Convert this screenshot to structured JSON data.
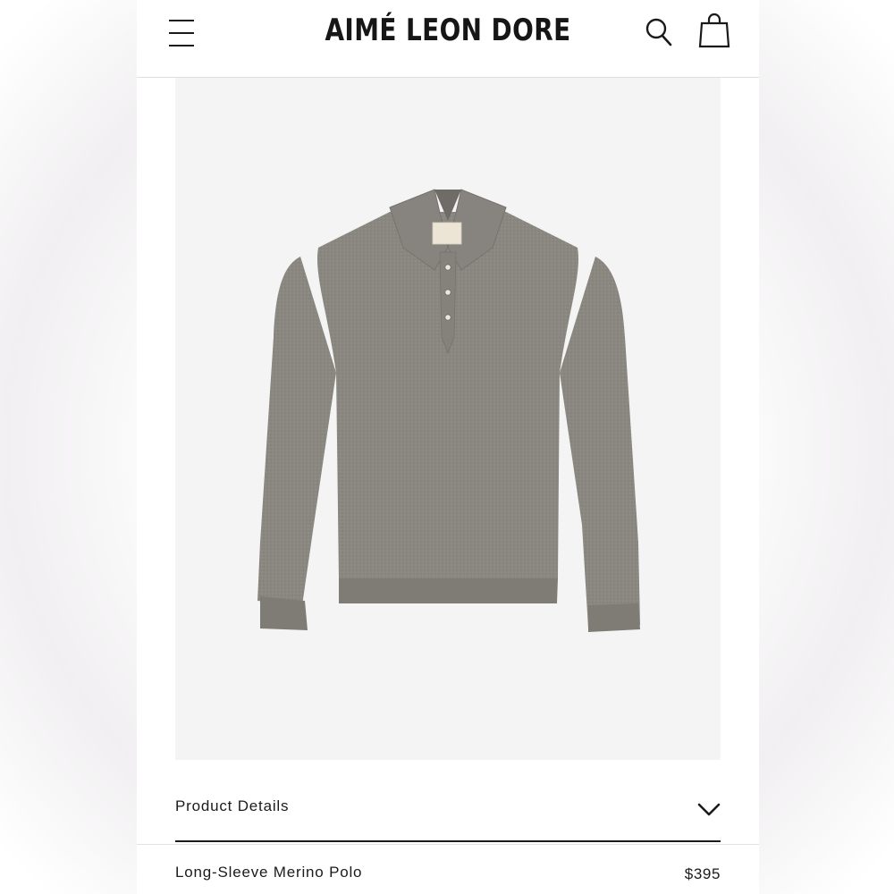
{
  "header": {
    "logo_text": "AIMÉ LEON DORE",
    "menu_icon": "hamburger-menu-icon",
    "search_icon": "search-icon",
    "bag_icon": "shopping-bag-icon"
  },
  "product": {
    "image_alt": "Grey long-sleeve knit polo",
    "garment_color": "#8a8780",
    "name": "Long-Sleeve Merino Polo",
    "price": "$395"
  },
  "details": {
    "label": "Product Details",
    "toggle_icon": "chevron-down-icon"
  },
  "colors": {
    "text": "#1b1b1b",
    "image_background": "#f4f4f5",
    "divider": "#dedede"
  }
}
